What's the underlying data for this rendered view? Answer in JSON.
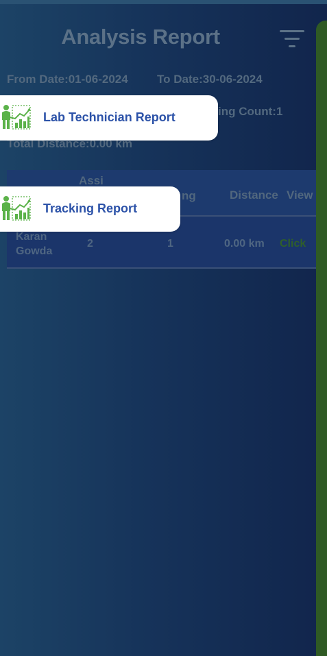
{
  "header": {
    "title": "Analysis Report",
    "filter_icon": "filter-icon"
  },
  "summary": {
    "from_date": "From Date:01-06-2024",
    "to_date": "To Date:30-06-2024",
    "pending_count_partial": "ing Count:1",
    "total_distance": "Total Distance:0.00 km"
  },
  "table": {
    "headers": {
      "assigned_partial": "Assi",
      "pending_partial": "ng",
      "distance": "Distance",
      "view": "View"
    },
    "rows": [
      {
        "name_line1": "Karan",
        "name_line2": "Gowda",
        "assigned": "2",
        "pending": "1",
        "distance": "0.00 km",
        "view_link": "Click"
      }
    ]
  },
  "menu": {
    "items": [
      {
        "label": "Lab Technician Report",
        "icon": "analytics-person-icon"
      },
      {
        "label": "Tracking Report",
        "icon": "analytics-person-icon"
      }
    ]
  },
  "colors": {
    "background_left": "#1c4366",
    "background_right": "#11254c",
    "menu_text": "#2c52a8",
    "drawer_panel": "#2f5a24",
    "icon_green": "#5bb249"
  }
}
